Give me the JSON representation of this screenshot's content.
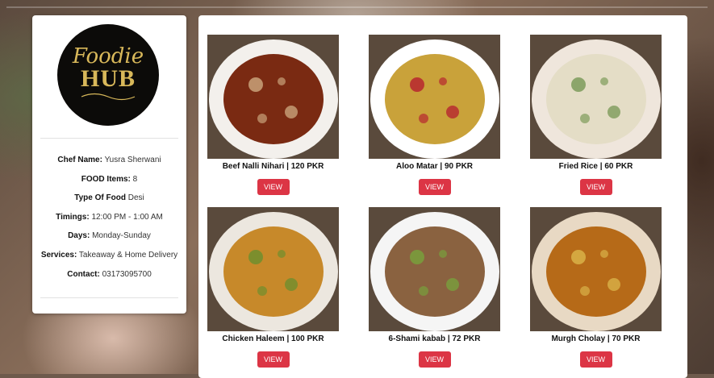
{
  "brand": {
    "logo_word1": "Foodie",
    "logo_word2": "HUB"
  },
  "chef": [
    {
      "label": "Chef Name:",
      "value": "Yusra Sherwani"
    },
    {
      "label": "FOOD Items:",
      "value": "8"
    },
    {
      "label": "Type Of Food",
      "value": "Desi"
    },
    {
      "label": "Timings:",
      "value": "12:00 PM - 1:00 AM"
    },
    {
      "label": "Days:",
      "value": "Monday-Sunday"
    },
    {
      "label": "Services:",
      "value": "Takeaway & Home Delivery"
    },
    {
      "label": "Contact:",
      "value": "03173095700"
    }
  ],
  "items": [
    {
      "caption": "Beef Nalli Nihari | 120 PKR",
      "button": "VIEW",
      "image": "nihari-dish",
      "plate": "#f3f0ec",
      "food": "#7a2a12",
      "accent": "#c9a27a"
    },
    {
      "caption": "Aloo Matar | 90 PKR",
      "button": "VIEW",
      "image": "aloo-matar-dish",
      "plate": "#ffffff",
      "food": "#c9a23a",
      "accent": "#b7262f"
    },
    {
      "caption": "Fried Rice | 60 PKR",
      "button": "VIEW",
      "image": "fried-rice-dish",
      "plate": "#efe6dc",
      "food": "#e4ddc6",
      "accent": "#7d9b5a"
    },
    {
      "caption": "Chicken Haleem | 100 PKR",
      "button": "VIEW",
      "image": "haleem-dish",
      "plate": "#ece7df",
      "food": "#c7892a",
      "accent": "#6f8f2e"
    },
    {
      "caption": "6-Shami kabab | 72 PKR",
      "button": "VIEW",
      "image": "shami-kabab-dish",
      "plate": "#f5f5f5",
      "food": "#8a6240",
      "accent": "#78a03c"
    },
    {
      "caption": "Murgh Cholay | 70 PKR",
      "button": "VIEW",
      "image": "cholay-dish",
      "plate": "#e8d9c4",
      "food": "#b66a18",
      "accent": "#d9b248"
    }
  ]
}
